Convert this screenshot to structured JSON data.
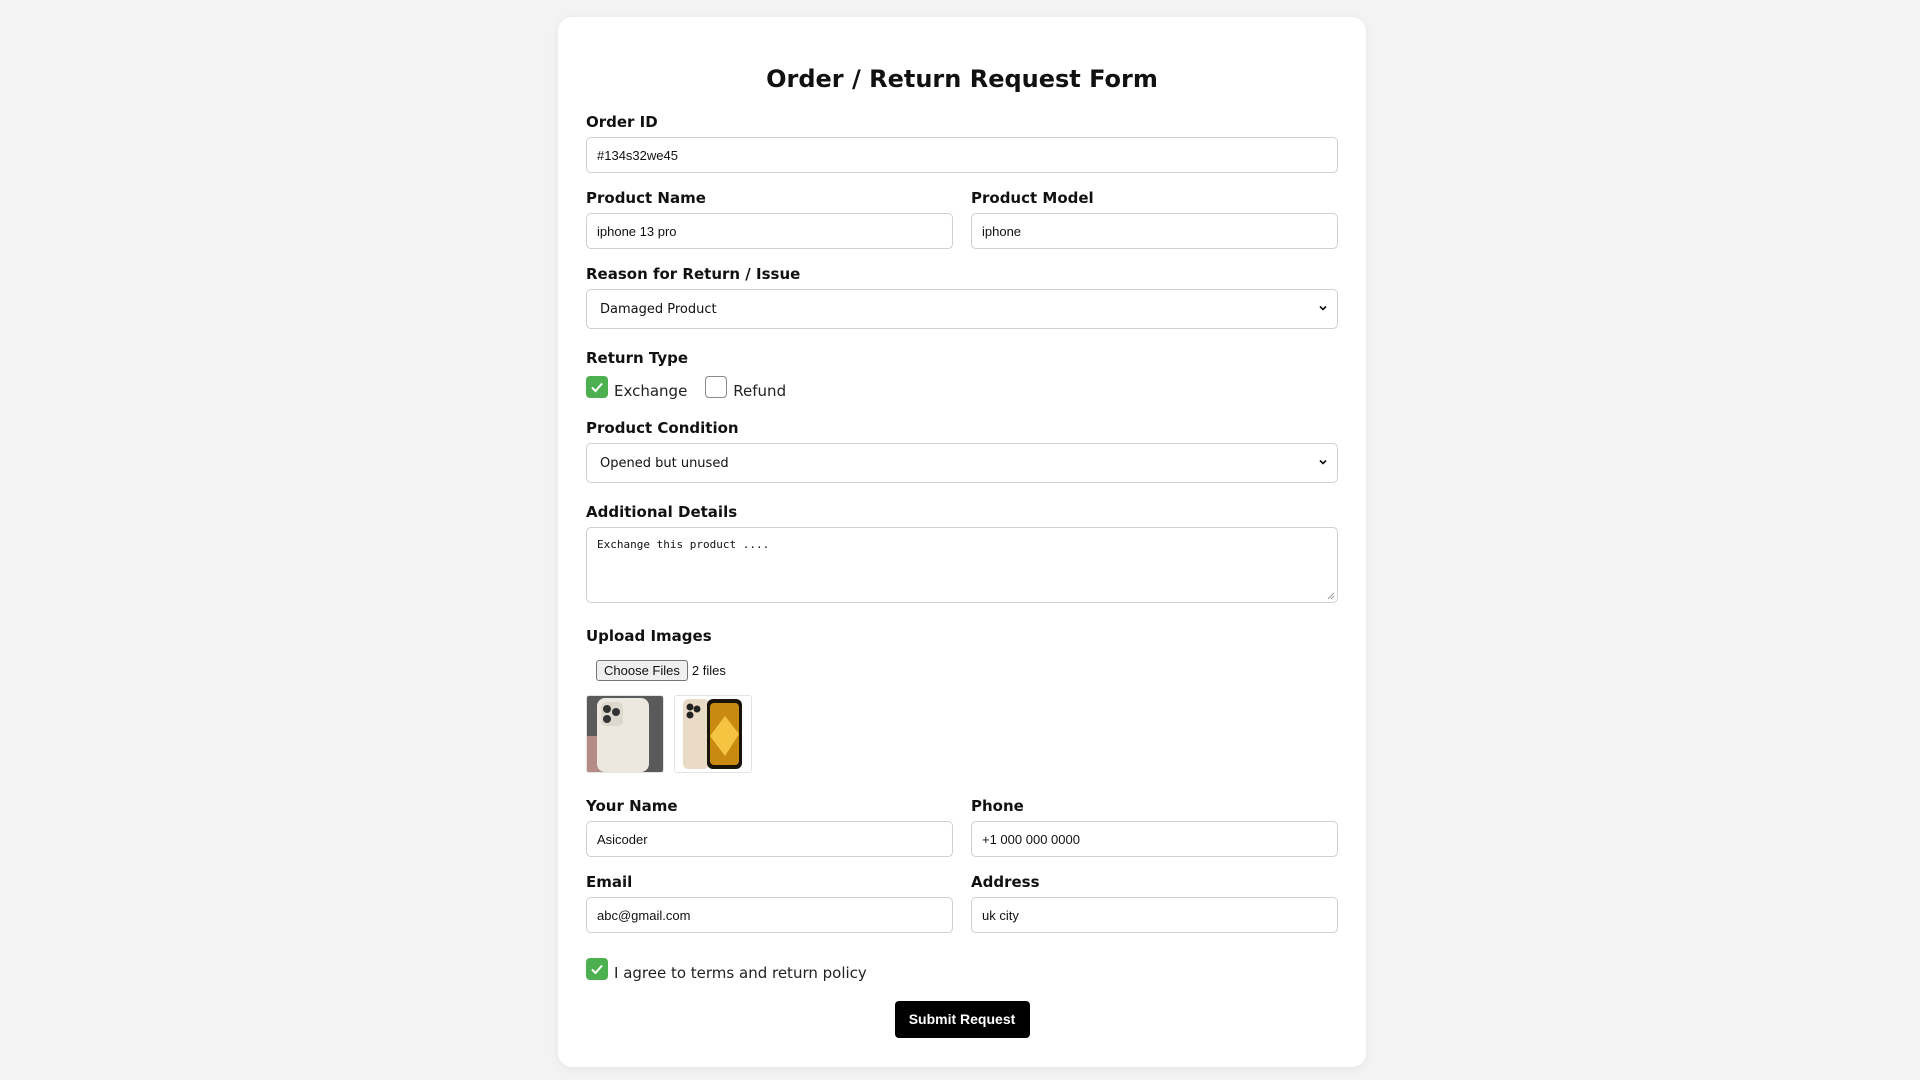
{
  "form": {
    "title": "Order / Return Request Form",
    "order_id": {
      "label": "Order ID",
      "value": "#134s32we45"
    },
    "product_name": {
      "label": "Product Name",
      "value": "iphone 13 pro"
    },
    "product_model": {
      "label": "Product Model",
      "value": "iphone"
    },
    "reason": {
      "label": "Reason for Return / Issue",
      "selected": "Damaged Product"
    },
    "return_type": {
      "label": "Return Type",
      "options": [
        {
          "label": "Exchange",
          "checked": true
        },
        {
          "label": "Refund",
          "checked": false
        }
      ]
    },
    "condition": {
      "label": "Product Condition",
      "selected": "Opened but unused"
    },
    "details": {
      "label": "Additional Details",
      "value": "Exchange this product ...."
    },
    "upload": {
      "label": "Upload Images",
      "button_label": "Choose Files",
      "status": "2 files",
      "thumbnails": [
        "iphone-silver-back-photo",
        "iphone-gold-photo"
      ]
    },
    "your_name": {
      "label": "Your Name",
      "value": "Asicoder"
    },
    "phone": {
      "label": "Phone",
      "value": "+1 000 000 0000"
    },
    "email": {
      "label": "Email",
      "value": "abc@gmail.com"
    },
    "address": {
      "label": "Address",
      "value": "uk city"
    },
    "agree": {
      "label": "I agree to terms and return policy",
      "checked": true
    },
    "submit_label": "Submit Request"
  },
  "colors": {
    "checkbox_checked": "#4caf50",
    "submit_bg": "#000000",
    "page_bg": "#f3f3f3",
    "card_bg": "#ffffff"
  }
}
